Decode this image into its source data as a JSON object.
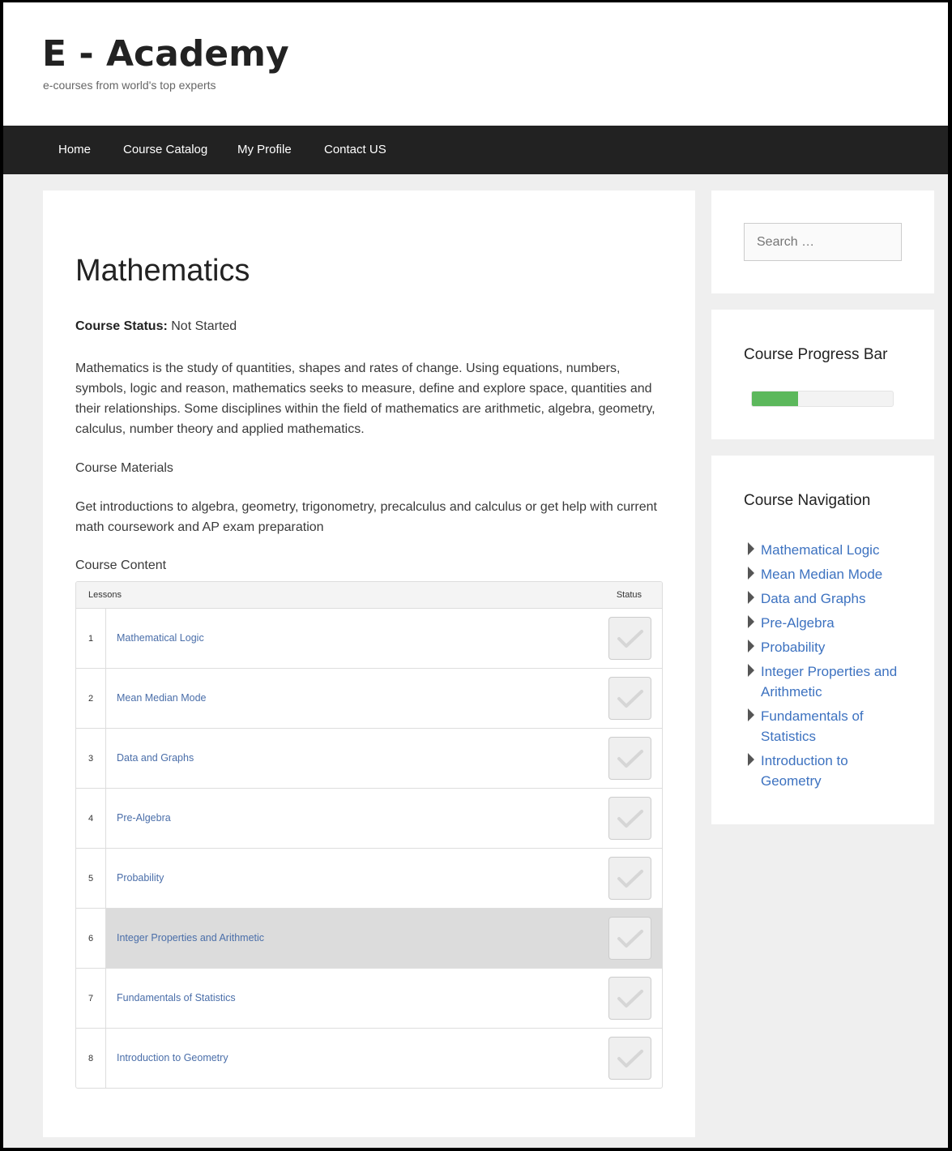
{
  "site": {
    "title": "E - Academy",
    "tagline": "e-courses from world's top experts"
  },
  "nav": {
    "items": [
      "Home",
      "Course Catalog",
      "My Profile",
      "Contact US"
    ]
  },
  "course": {
    "title": "Mathematics",
    "status_label": "Course Status:",
    "status_value": "Not Started",
    "description": "Mathematics is the study of quantities, shapes and rates of change. Using equations, numbers, symbols, logic and reason, mathematics seeks to measure, define and explore space, quantities and their relationships. Some disciplines within the field of mathematics are arithmetic, algebra, geometry, calculus, number theory and applied mathematics.",
    "materials_heading": "Course Materials",
    "materials_text": "Get introductions to algebra, geometry, trigonometry, precalculus and calculus or get help with current math coursework and AP exam preparation",
    "content_heading": "Course Content"
  },
  "table": {
    "header_lessons": "Lessons",
    "header_status": "Status",
    "rows": [
      {
        "num": "1",
        "title": "Mathematical Logic",
        "completed": false,
        "highlighted": false
      },
      {
        "num": "2",
        "title": "Mean Median Mode",
        "completed": false,
        "highlighted": false
      },
      {
        "num": "3",
        "title": "Data and Graphs",
        "completed": false,
        "highlighted": false
      },
      {
        "num": "4",
        "title": "Pre-Algebra",
        "completed": false,
        "highlighted": false
      },
      {
        "num": "5",
        "title": "Probability",
        "completed": false,
        "highlighted": false
      },
      {
        "num": "6",
        "title": "Integer Properties and Arithmetic",
        "completed": false,
        "highlighted": true
      },
      {
        "num": "7",
        "title": "Fundamentals of Statistics",
        "completed": false,
        "highlighted": false
      },
      {
        "num": "8",
        "title": "Introduction to Geometry",
        "completed": false,
        "highlighted": false
      }
    ]
  },
  "sidebar": {
    "search_placeholder": "Search …",
    "progress_title": "Course Progress Bar",
    "progress_fraction": 0.33,
    "progress_color": "#5cb85c",
    "nav_title": "Course Navigation",
    "nav_items": [
      "Mathematical Logic",
      "Mean Median Mode",
      "Data and Graphs",
      "Pre-Algebra",
      "Probability",
      "Integer Properties and Arithmetic",
      "Fundamentals of Statistics",
      "Introduction to Geometry"
    ]
  }
}
